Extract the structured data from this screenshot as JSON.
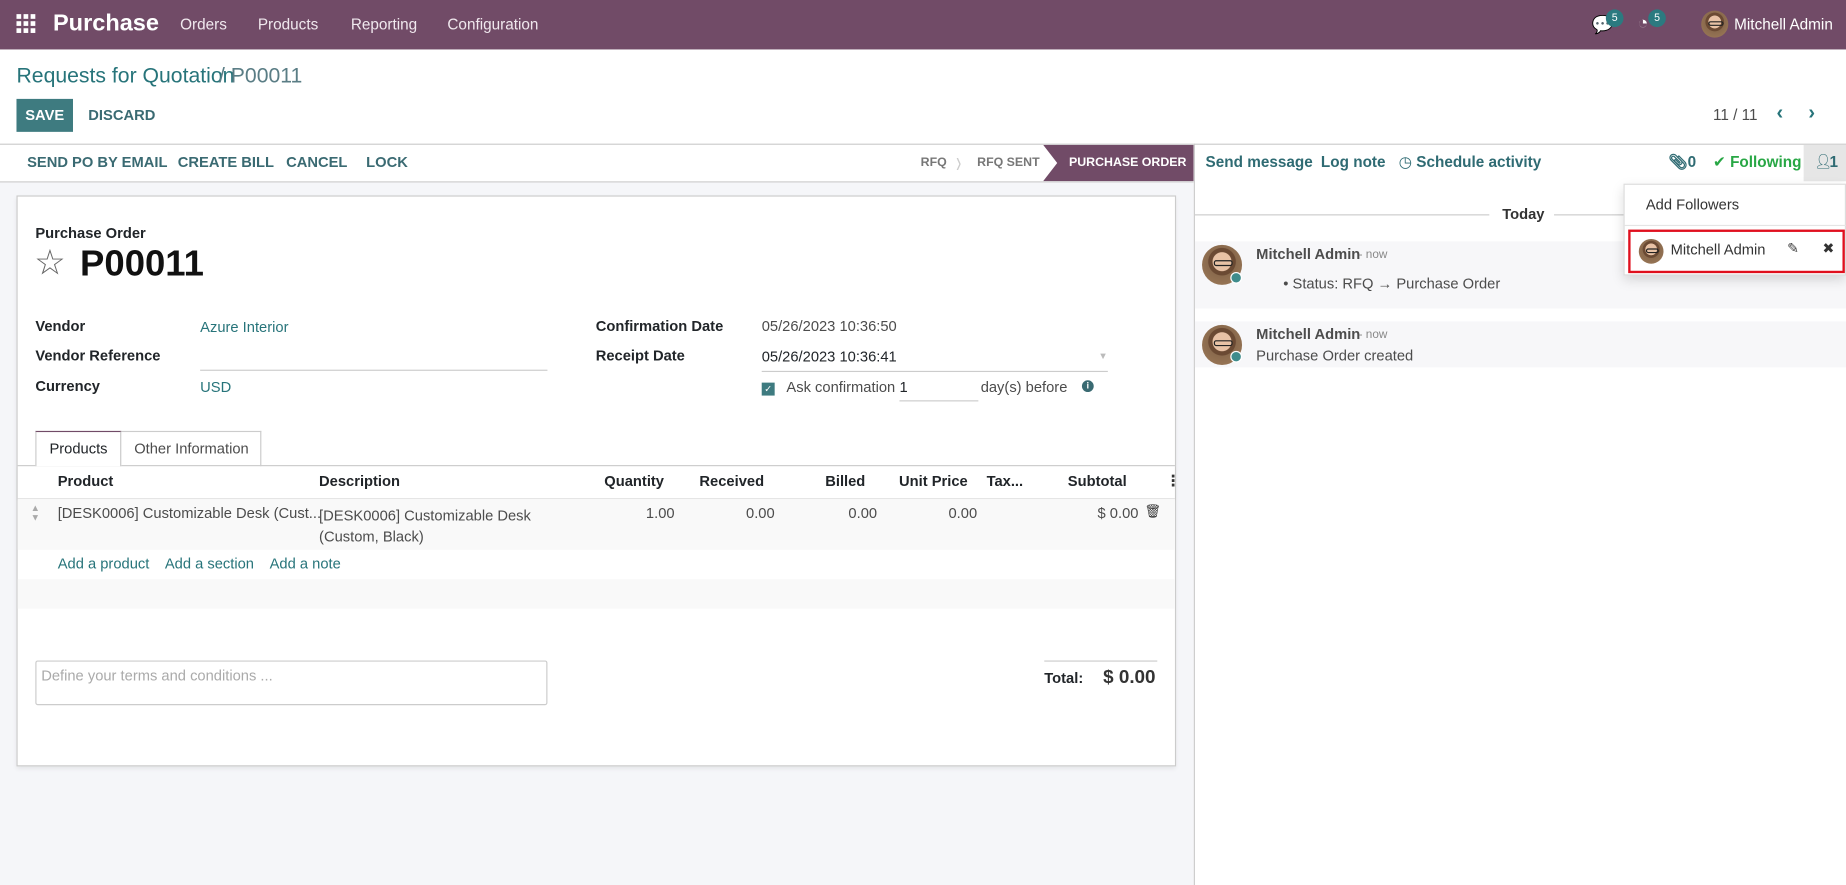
{
  "navbar": {
    "app_name": "Purchase",
    "menus": [
      "Orders",
      "Products",
      "Reporting",
      "Configuration"
    ],
    "messages_count": "5",
    "activities_count": "5",
    "user_name": "Mitchell Admin"
  },
  "breadcrumb": {
    "parent": "Requests for Quotation",
    "separator": " / ",
    "current": "P00011"
  },
  "actions": {
    "save": "SAVE",
    "discard": "DISCARD"
  },
  "pager": {
    "value": "11 / 11"
  },
  "statusbar": {
    "buttons": [
      "SEND PO BY EMAIL",
      "CREATE BILL",
      "CANCEL",
      "LOCK"
    ],
    "stages": [
      "RFQ",
      "RFQ SENT",
      "PURCHASE ORDER"
    ],
    "active_stage": "PURCHASE ORDER"
  },
  "form": {
    "subtitle": "Purchase Order",
    "name": "P00011",
    "vendor_label": "Vendor",
    "vendor": "Azure Interior",
    "vendor_ref_label": "Vendor Reference",
    "vendor_ref": "",
    "currency_label": "Currency",
    "currency": "USD",
    "confirmation_date_label": "Confirmation Date",
    "confirmation_date": "05/26/2023 10:36:50",
    "receipt_date_label": "Receipt Date",
    "receipt_date": "05/26/2023 10:36:41",
    "ask_confirmation_label": "Ask confirmation",
    "ask_confirmation_checked": true,
    "ask_days": "1",
    "days_before_label": "day(s) before",
    "tabs": [
      "Products",
      "Other Information"
    ],
    "table": {
      "headers": [
        "Product",
        "Description",
        "Quantity",
        "Received",
        "Billed",
        "Unit Price",
        "Tax...",
        "Subtotal"
      ],
      "rows": [
        {
          "product": "[DESK0006] Customizable Desk (Cust...",
          "description_line1": "[DESK0006] Customizable Desk",
          "description_line2": "(Custom, Black)",
          "quantity": "1.00",
          "received": "0.00",
          "billed": "0.00",
          "unit_price": "0.00",
          "taxes": "",
          "subtotal": "$ 0.00"
        }
      ],
      "add_links": [
        "Add a product",
        "Add a section",
        "Add a note"
      ]
    },
    "terms_placeholder": "Define your terms and conditions ...",
    "total_label": "Total:",
    "total": "$ 0.00"
  },
  "chatter": {
    "send_message": "Send message",
    "log_note": "Log note",
    "schedule_activity": "Schedule activity",
    "attachments_count": "0",
    "following": "Following",
    "followers_count": "1",
    "date_separator": "Today",
    "messages": [
      {
        "author": "Mitchell Admin",
        "time": "- now",
        "body": "Status: RFQ → Purchase Order"
      },
      {
        "author": "Mitchell Admin",
        "time": "- now",
        "body": "Purchase Order created"
      }
    ],
    "followers_dropdown": {
      "add_followers": "Add Followers",
      "followers": [
        "Mitchell Admin"
      ]
    }
  },
  "colors": {
    "brand": "#714B67",
    "primary": "#3e7b80",
    "following": "#28a745",
    "highlight": "#e0101e"
  }
}
